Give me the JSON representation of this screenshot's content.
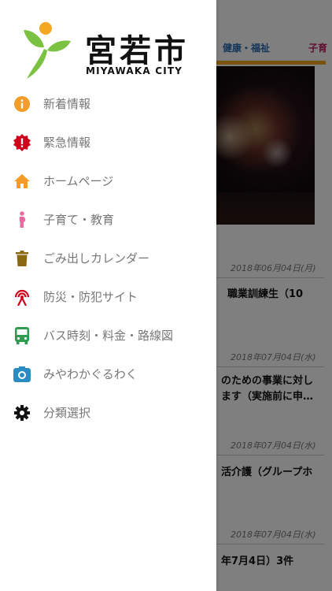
{
  "app": {
    "logo_title": "宮若市",
    "logo_subtitle": "MIYAWAKA CITY"
  },
  "colors": {
    "logo_green": "#7cc242",
    "logo_orange": "#f5a623",
    "overlay": "#808080"
  },
  "menu": [
    {
      "label": "新着情報",
      "icon": "info-icon",
      "color": "#f39c29"
    },
    {
      "label": "緊急情報",
      "icon": "alert-badge-icon",
      "color": "#d0021b"
    },
    {
      "label": "ホームページ",
      "icon": "home-icon",
      "color": "#f39c29"
    },
    {
      "label": "子育て・教育",
      "icon": "mother-icon",
      "color": "#e96aa5"
    },
    {
      "label": "ごみ出しカレンダー",
      "icon": "trash-icon",
      "color": "#8b6914"
    },
    {
      "label": "防災・防犯サイト",
      "icon": "broadcast-icon",
      "color": "#d0021b"
    },
    {
      "label": "バス時刻・料金・路線図",
      "icon": "bus-icon",
      "color": "#2e9a52"
    },
    {
      "label": "みやわかぐるわく",
      "icon": "camera-icon",
      "color": "#2b8cc4"
    },
    {
      "label": "分類選択",
      "icon": "gear-icon",
      "color": "#111111"
    }
  ],
  "background": {
    "tabs": [
      {
        "label": "健康・福祉",
        "color": "#2b6cb0"
      },
      {
        "label": "子育",
        "color": "#c2185b"
      }
    ],
    "tab_underline_color": "#f5a623",
    "news": [
      {
        "date": "2018年06月04日(月)",
        "title": "職業訓練生（10"
      },
      {
        "date": "2018年07月04日(水)",
        "title": "のための事業に対し",
        "title2": "ます（実施前に申…"
      },
      {
        "date": "2018年07月04日(水)",
        "title": "活介護（グループホ"
      },
      {
        "date": "2018年07月04日(水)",
        "title": "年7月4日）3件"
      }
    ]
  }
}
